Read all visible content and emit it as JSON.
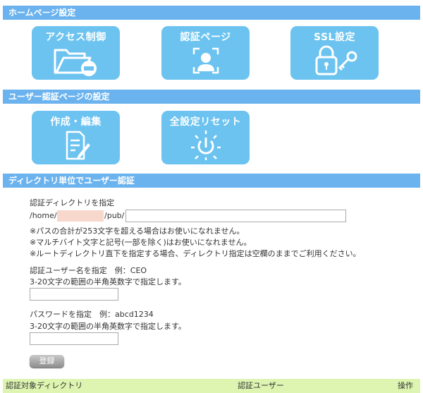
{
  "sections": {
    "homepage": "ホームページ設定",
    "auth_page": "ユーザー認証ページの設定",
    "dir_auth": "ディレクトリ単位でユーザー認証"
  },
  "tiles": {
    "access": "アクセス制御",
    "auth_page": "認証ページ",
    "ssl": "SSL設定",
    "create_edit": "作成・編集",
    "reset": "全設定リセット"
  },
  "form": {
    "dir_label": "認証ディレクトリを指定",
    "path_prefix": "/home/",
    "path_mid": "/pub/",
    "dir_value": "",
    "notes": [
      "※パスの合計が253文字を超える場合はお使いになれません。",
      "※マルチバイト文字と記号(一部を除く)はお使いになれません。",
      "※ルートディレクトリ直下を指定する場合、ディレクトリ指定は空欄のままでご利用ください。"
    ],
    "user_label": "認証ユーザー名を指定　例：CEO",
    "user_hint": "3-20文字の範囲の半角英数字で指定します。",
    "user_value": "",
    "pass_label": "パスワードを指定　例：abcd1234",
    "pass_hint": "3-20文字の範囲の半角英数字で指定します。",
    "pass_value": "",
    "submit": "登録"
  },
  "table": {
    "headers": [
      "認証対象ディレクトリ",
      "認証ユーザー",
      "操作"
    ]
  },
  "colors": {
    "header_bg": "#6bb3ee",
    "tile_bg": "#6cc3f0",
    "table_head_bg": "#ddf5b0"
  }
}
